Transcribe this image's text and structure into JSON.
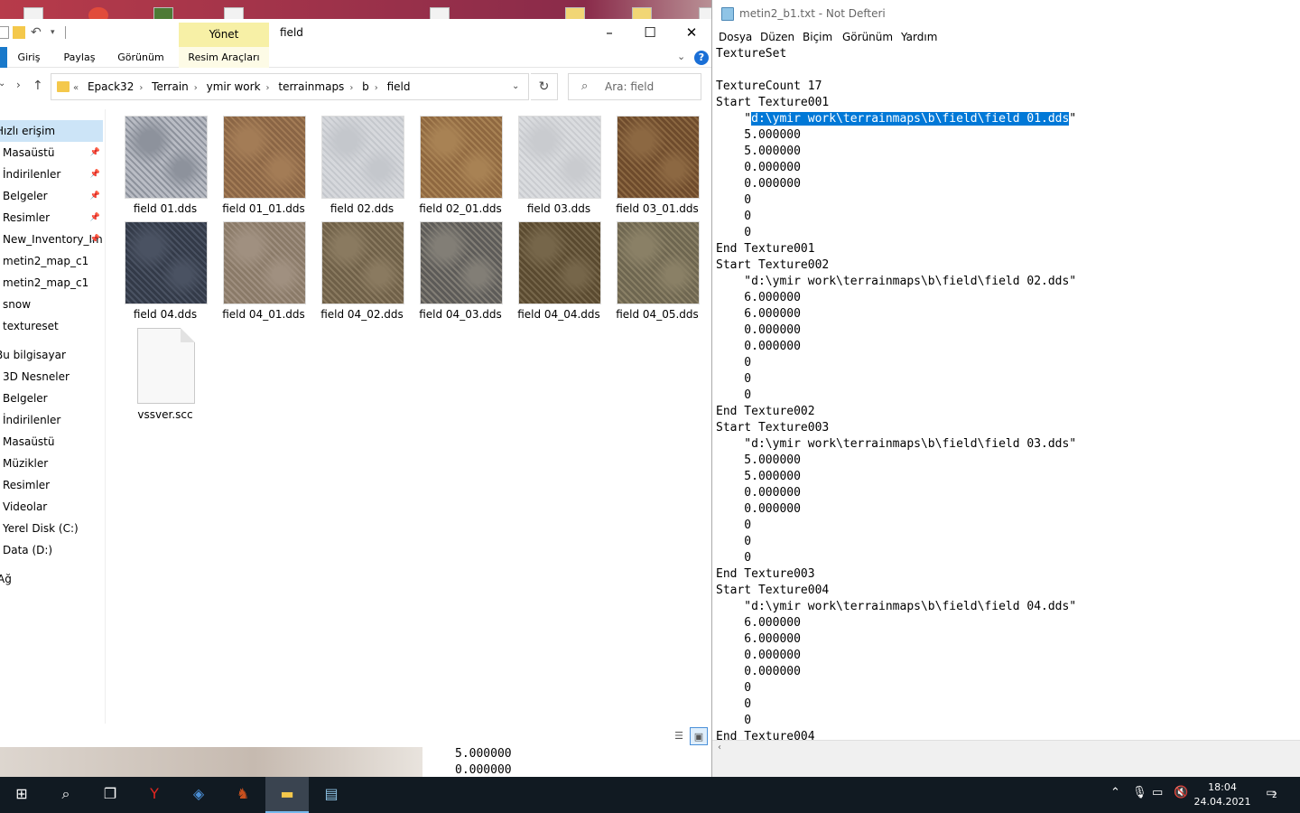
{
  "explorer": {
    "window_title": "field",
    "context_tab": "Yönet",
    "ribbon_tabs": [
      "Giriş",
      "Paylaş",
      "Görünüm",
      "Resim Araçları"
    ],
    "breadcrumb": [
      "Epack32",
      "Terrain",
      "ymir work",
      "terrainmaps",
      "b",
      "field"
    ],
    "breadcrumb_prefix": "«",
    "search_placeholder": "Ara: field",
    "nav": [
      {
        "label": "Hızlı erişim",
        "selected": true
      },
      {
        "label": "Masaüstü",
        "pinned": true
      },
      {
        "label": "İndirilenler",
        "pinned": true
      },
      {
        "label": "Belgeler",
        "pinned": true
      },
      {
        "label": "Resimler",
        "pinned": true
      },
      {
        "label": "New_Inventory_Im",
        "pinned": true
      },
      {
        "label": "metin2_map_c1"
      },
      {
        "label": "metin2_map_c1"
      },
      {
        "label": "snow"
      },
      {
        "label": "textureset"
      },
      {
        "label": "Bu bilgisayar"
      },
      {
        "label": "3D Nesneler"
      },
      {
        "label": "Belgeler"
      },
      {
        "label": "İndirilenler"
      },
      {
        "label": "Masaüstü"
      },
      {
        "label": "Müzikler"
      },
      {
        "label": "Resimler"
      },
      {
        "label": "Videolar"
      },
      {
        "label": "Yerel Disk (C:)"
      },
      {
        "label": "Data (D:)"
      },
      {
        "label": "Ağ"
      }
    ],
    "files": [
      {
        "name": "field 01.dds",
        "color": "#b9bcc4",
        "color2": "#8d929c"
      },
      {
        "name": "field 01_01.dds",
        "color": "#8a6545",
        "color2": "#a37c56"
      },
      {
        "name": "field 02.dds",
        "color": "#d6d8dc",
        "color2": "#c4c7cc"
      },
      {
        "name": "field 02_01.dds",
        "color": "#8f6840",
        "color2": "#a88254"
      },
      {
        "name": "field 03.dds",
        "color": "#dadcdf",
        "color2": "#c9cbcf"
      },
      {
        "name": "field 03_01.dds",
        "color": "#6e4b2c",
        "color2": "#8c6842"
      },
      {
        "name": "field 04.dds",
        "color": "#333a48",
        "color2": "#4a5262"
      },
      {
        "name": "field 04_01.dds",
        "color": "#8a7a68",
        "color2": "#a09080"
      },
      {
        "name": "field 04_02.dds",
        "color": "#6f6048",
        "color2": "#8a7a60"
      },
      {
        "name": "field 04_03.dds",
        "color": "#5d5b58",
        "color2": "#827e76"
      },
      {
        "name": "field 04_04.dds",
        "color": "#5a4a30",
        "color2": "#76664a"
      },
      {
        "name": "field 04_05.dds",
        "color": "#6e6650",
        "color2": "#8a8066"
      },
      {
        "name": "vssver.scc",
        "doc": true
      }
    ]
  },
  "notepad": {
    "title": "metin2_b1.txt - Not Defteri",
    "menu": [
      "Dosya",
      "Düzen",
      "Biçim",
      "Görünüm",
      "Yardım"
    ],
    "lines": [
      "TextureSet",
      "",
      "TextureCount 17",
      "Start Texture001",
      "    \"d:\\ymir work\\terrainmaps\\b\\field\\field 01.dds\"",
      "    5.000000",
      "    5.000000",
      "    0.000000",
      "    0.000000",
      "    0",
      "    0",
      "    0",
      "End Texture001",
      "Start Texture002",
      "    \"d:\\ymir work\\terrainmaps\\b\\field\\field 02.dds\"",
      "    6.000000",
      "    6.000000",
      "    0.000000",
      "    0.000000",
      "    0",
      "    0",
      "    0",
      "End Texture002",
      "Start Texture003",
      "    \"d:\\ymir work\\terrainmaps\\b\\field\\field 03.dds\"",
      "    5.000000",
      "    5.000000",
      "    0.000000",
      "    0.000000",
      "    0",
      "    0",
      "    0",
      "End Texture003",
      "Start Texture004",
      "    \"d:\\ymir work\\terrainmaps\\b\\field\\field 04.dds\"",
      "    6.000000",
      "    6.000000",
      "    0.000000",
      "    0.000000",
      "    0",
      "    0",
      "    0",
      "End Texture004"
    ],
    "selection": {
      "line": 4,
      "text": "d:\\ymir work\\terrainmaps\\b\\field\\field 01.dds"
    }
  },
  "background_note": {
    "lines": [
      "5.000000",
      "0.000000",
      "0.000000"
    ]
  },
  "taskbar": {
    "apps": [
      {
        "name": "start-icon",
        "glyph": "⊞"
      },
      {
        "name": "search-icon",
        "glyph": "⌕"
      },
      {
        "name": "task-view-icon",
        "glyph": "❐"
      },
      {
        "name": "yandex-browser-icon",
        "glyph": "Y",
        "color": "#e52620"
      },
      {
        "name": "virtualbox-icon",
        "glyph": "◈",
        "color": "#4b8fd6"
      },
      {
        "name": "game-app-icon",
        "glyph": "♞",
        "color": "#c8501e"
      },
      {
        "name": "file-explorer-icon",
        "glyph": "▬",
        "color": "#f4c84b",
        "active": true
      },
      {
        "name": "notepad-icon",
        "glyph": "▤",
        "color": "#8fc4e6"
      }
    ],
    "time": "18:04",
    "date": "24.04.2021",
    "notifications": "2",
    "tray": [
      "chevron-up-icon",
      "microphone-icon",
      "network-icon",
      "volume-muted-icon"
    ]
  }
}
